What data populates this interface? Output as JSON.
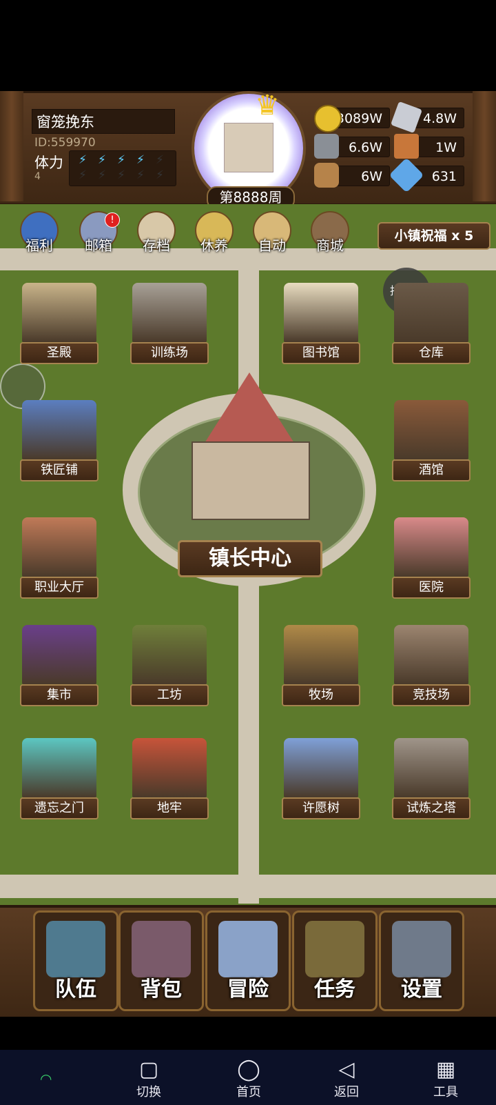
{
  "player": {
    "name": "窗笼挽东",
    "id": "ID:559970",
    "stamina_label": "体力",
    "stamina_value": "4",
    "week": "第8888周"
  },
  "resources": [
    {
      "name": "gold",
      "value": "3089W",
      "color": "#e7c02f"
    },
    {
      "name": "iron",
      "value": "4.8W",
      "color": "#c9ccd4"
    },
    {
      "name": "stone",
      "value": "6.6W",
      "color": "#8a8f96"
    },
    {
      "name": "leather",
      "value": "1W",
      "color": "#c8773a"
    },
    {
      "name": "wood",
      "value": "6W",
      "color": "#b6834a"
    },
    {
      "name": "crystal",
      "value": "631",
      "color": "#5fa7e8"
    }
  ],
  "top_icons": [
    {
      "label": "福利",
      "icon": "welfare-shield-icon"
    },
    {
      "label": "邮箱",
      "icon": "mailbox-icon",
      "badge": "!"
    },
    {
      "label": "存档",
      "icon": "save-scroll-icon"
    },
    {
      "label": "休养",
      "icon": "rest-book-icon"
    },
    {
      "label": "自动",
      "icon": "auto-map-icon"
    },
    {
      "label": "商城",
      "icon": "shop-icon"
    }
  ],
  "blessing": "小镇祝福 x 5",
  "hosted": "托管关",
  "mayor_center": "镇长中心",
  "buildings": [
    {
      "label": "圣殿",
      "color": "#c9b48a"
    },
    {
      "label": "训练场",
      "color": "#a8a197"
    },
    {
      "label": "图书馆",
      "color": "#e8dcc0"
    },
    {
      "label": "仓库",
      "color": "#6b5a48"
    },
    {
      "label": "铁匠铺",
      "color": "#5b7ec0"
    },
    {
      "label": "酒馆",
      "color": "#8a5a3a"
    },
    {
      "label": "职业大厅",
      "color": "#c07a58"
    },
    {
      "label": "医院",
      "color": "#d98a8a"
    },
    {
      "label": "集市",
      "color": "#6a3f8a"
    },
    {
      "label": "工坊",
      "color": "#6f7f3a"
    },
    {
      "label": "牧场",
      "color": "#b08a48"
    },
    {
      "label": "竞技场",
      "color": "#9c8570"
    },
    {
      "label": "遗忘之门",
      "color": "#5cc7c2"
    },
    {
      "label": "地牢",
      "color": "#c7543a"
    },
    {
      "label": "许愿树",
      "color": "#7fa0d8"
    },
    {
      "label": "试炼之塔",
      "color": "#a0958a"
    }
  ],
  "bottom_nav": [
    {
      "label": "队伍",
      "icon": "helmet-icon",
      "color": "#4f7a8f"
    },
    {
      "label": "背包",
      "icon": "backpack-icon",
      "color": "#7a5a6a"
    },
    {
      "label": "冒险",
      "icon": "crossed-swords-icon",
      "color": "#8aa2c8"
    },
    {
      "label": "任务",
      "icon": "quest-scroll-icon",
      "color": "#7a6a3a"
    },
    {
      "label": "设置",
      "icon": "gear-icon",
      "color": "#6f7a8a"
    }
  ],
  "system_nav": [
    {
      "label": "切换",
      "icon": "square-icon"
    },
    {
      "label": "首页",
      "icon": "circle-icon"
    },
    {
      "label": "返回",
      "icon": "triangle-back-icon"
    },
    {
      "label": "工具",
      "icon": "grid-icon"
    }
  ]
}
